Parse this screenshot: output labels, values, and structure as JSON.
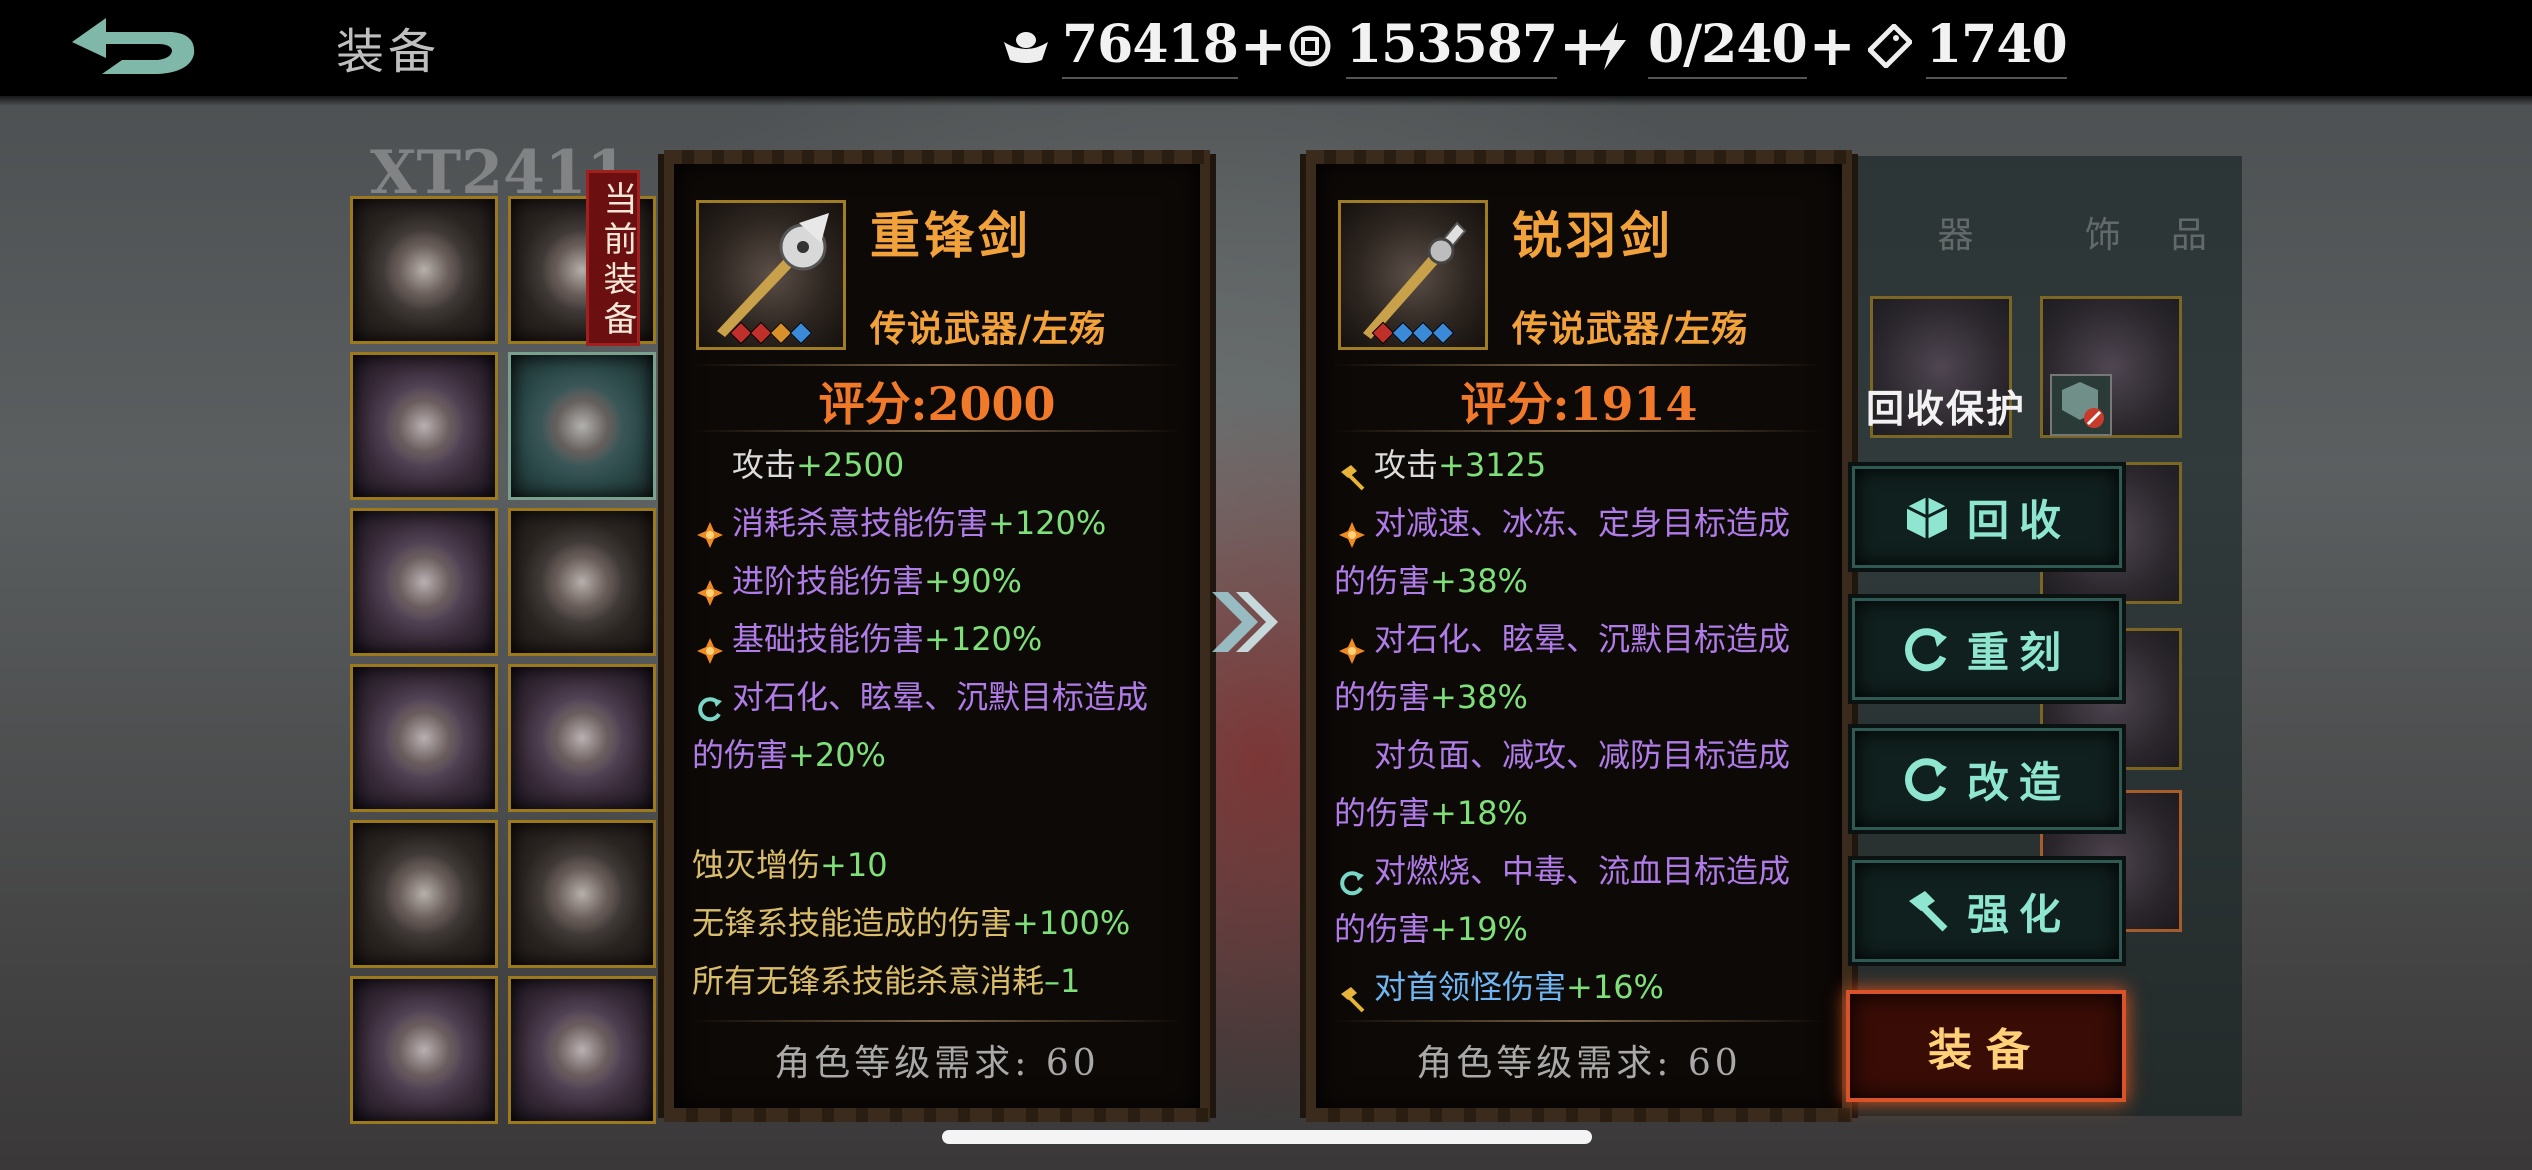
{
  "header": {
    "title": "装备",
    "resources": [
      {
        "name": "silver",
        "icon": "ingot-icon",
        "value": "76418",
        "has_plus": true
      },
      {
        "name": "coin",
        "icon": "coin-icon",
        "value": "153587",
        "has_plus": true
      },
      {
        "name": "stamina",
        "icon": "lightning-icon",
        "value": "0/240",
        "has_plus": true
      },
      {
        "name": "ticket",
        "icon": "ticket-icon",
        "value": "1740",
        "has_plus": false
      }
    ]
  },
  "inventory": {
    "ghost_text": "XT2411",
    "current_tag": "当前装备"
  },
  "current_item": {
    "name": "重锋剑",
    "type": "传说武器/左殇",
    "score": "评分:2000",
    "gems": [
      "#c0302a",
      "#c0302a",
      "#d8902a",
      "#3a8ad8"
    ],
    "stats": [
      {
        "icon": "none",
        "text": "攻击",
        "plus": "+2500",
        "color": "white",
        "wrap": ""
      },
      {
        "icon": "diamond-icon",
        "text": "消耗杀意技能伤害",
        "plus": "+120%",
        "color": "purple",
        "wrap": ""
      },
      {
        "icon": "diamond-icon",
        "text": "进阶技能伤害",
        "plus": "+90%",
        "color": "purple",
        "wrap": ""
      },
      {
        "icon": "diamond-icon",
        "text": "基础技能伤害",
        "plus": "+120%",
        "color": "purple",
        "wrap": ""
      },
      {
        "icon": "refresh-icon",
        "text": "对石化、眩晕、沉默目标造成",
        "plus": "+20%",
        "color": "purple",
        "wrap": "的伤害"
      }
    ],
    "set_stats": [
      {
        "text": "蚀灭增伤",
        "plus": "+10"
      },
      {
        "text": "无锋系技能造成的伤害",
        "plus": "+100%"
      },
      {
        "text": "所有无锋系技能杀意消耗",
        "plus": "–1"
      }
    ],
    "requirement": "角色等级需求:  60"
  },
  "compare_item": {
    "name": "锐羽剑",
    "type": "传说武器/左殇",
    "score": "评分:1914",
    "gems": [
      "#c0302a",
      "#3a8ad8",
      "#3a8ad8",
      "#3a8ad8"
    ],
    "stats": [
      {
        "icon": "hammer-icon",
        "text": "攻击",
        "plus": "+3125",
        "color": "white",
        "wrap": ""
      },
      {
        "icon": "diamond-icon",
        "text": "对减速、冰冻、定身目标造成",
        "plus": "+38%",
        "color": "purple",
        "wrap": "的伤害"
      },
      {
        "icon": "diamond-icon",
        "text": "对石化、眩晕、沉默目标造成",
        "plus": "+38%",
        "color": "purple",
        "wrap": "的伤害"
      },
      {
        "icon": "none",
        "text": "对负面、减攻、减防目标造成",
        "plus": "+18%",
        "color": "purple",
        "wrap": "的伤害"
      },
      {
        "icon": "refresh-icon",
        "text": "对燃烧、中毒、流血目标造成",
        "plus": "+19%",
        "color": "purple",
        "wrap": "的伤害"
      },
      {
        "icon": "hammer-icon",
        "text": "对首领怪伤害",
        "plus": "+16%",
        "color": "blue",
        "wrap": ""
      }
    ],
    "requirement": "角色等级需求:  60"
  },
  "actions": {
    "protect_label": "回收保护",
    "recycle": "回收",
    "reforge": "重刻",
    "modify": "改造",
    "enhance": "强化",
    "equip": "装备"
  },
  "colors": {
    "item_name": "#f2a23a",
    "score": "#f07a2a",
    "stat_purple": "#b07ce8",
    "plus_green": "#7fe07a",
    "set_yellow": "#d9bd6a",
    "button_text": "#8fe6d0",
    "equip_border": "#d9532a"
  }
}
